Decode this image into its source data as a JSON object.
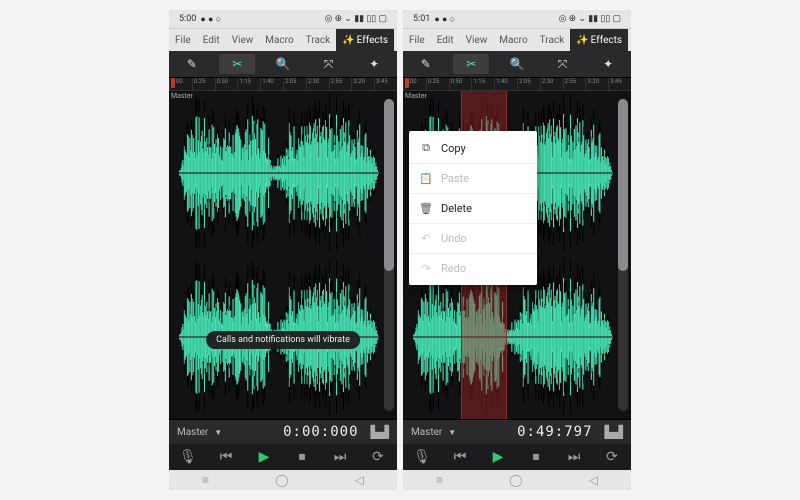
{
  "left": {
    "status": {
      "time": "5:00",
      "icons": "◎ ⊕ ⌄ ▮▮ ▯▯ ▢"
    },
    "menu": [
      {
        "label": "File",
        "active": false
      },
      {
        "label": "Edit",
        "active": false
      },
      {
        "label": "View",
        "active": false
      },
      {
        "label": "Macro",
        "active": false
      },
      {
        "label": "Track",
        "active": false
      },
      {
        "label": "Effects",
        "active": true
      }
    ],
    "timeline_ticks": [
      "0:00",
      "0:25",
      "0:50",
      "1:15",
      "1:40",
      "2:05",
      "2:30",
      "2:55",
      "3:20",
      "3:45"
    ],
    "track_label": "Master",
    "toast": "Calls and notifications will vibrate",
    "footer": {
      "track": "Master",
      "time": "0:00:000"
    },
    "context_visible": false,
    "selection_visible": false
  },
  "right": {
    "status": {
      "time": "5:01",
      "icons": "◎ ⊕ ⌄ ▮▮ ▯▯ ▢"
    },
    "menu": [
      {
        "label": "File",
        "active": false
      },
      {
        "label": "Edit",
        "active": false
      },
      {
        "label": "View",
        "active": false
      },
      {
        "label": "Macro",
        "active": false
      },
      {
        "label": "Track",
        "active": false
      },
      {
        "label": "Effects",
        "active": true
      }
    ],
    "timeline_ticks": [
      "0:00",
      "0:25",
      "0:50",
      "1:15",
      "1:40",
      "2:05",
      "2:30",
      "2:55",
      "3:20",
      "3:45"
    ],
    "track_label": "Master",
    "footer": {
      "track": "Master",
      "time": "0:49:797"
    },
    "context_visible": true,
    "context": [
      {
        "icon": "⧉",
        "label": "Copy",
        "disabled": false
      },
      {
        "icon": "📋",
        "label": "Paste",
        "disabled": true
      },
      {
        "icon": "🗑",
        "label": "Delete",
        "disabled": false
      },
      {
        "icon": "↶",
        "label": "Undo",
        "disabled": true
      },
      {
        "icon": "↷",
        "label": "Redo",
        "disabled": true
      }
    ],
    "selection_visible": true,
    "selection": {
      "left_pct": 24,
      "width_pct": 22
    }
  },
  "tool_icons": [
    "✎",
    "✂",
    "🔍",
    "⤧",
    "✦"
  ],
  "play_icons": [
    "🎙",
    "⏮",
    "▶",
    "⏹",
    "⏭",
    "⟳"
  ],
  "nav_icons": [
    "≡",
    "◯",
    "◁"
  ]
}
